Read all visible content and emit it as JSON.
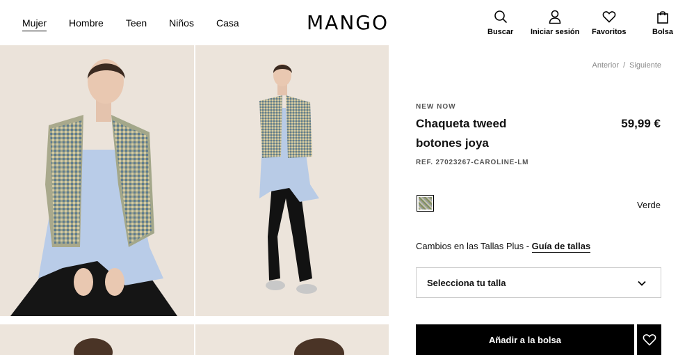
{
  "nav": {
    "items": [
      {
        "label": "Mujer",
        "active": true
      },
      {
        "label": "Hombre"
      },
      {
        "label": "Teen"
      },
      {
        "label": "Niños"
      },
      {
        "label": "Casa"
      }
    ]
  },
  "logo": "MANGO",
  "utilities": {
    "search": "Buscar",
    "login": "Iniciar sesión",
    "favorites": "Favoritos",
    "bag": "Bolsa"
  },
  "pager": {
    "prev": "Anterior",
    "separator": "/",
    "next": "Siguiente"
  },
  "product": {
    "tag": "NEW NOW",
    "title": "Chaqueta tweed botones joya",
    "price": "59,99 €",
    "ref": "REF. 27023267-CAROLINE-LM",
    "color_name": "Verde",
    "size_plus_text": "Cambios en las Tallas Plus - ",
    "size_guide": "Guía de tallas",
    "size_select_placeholder": "Selecciona tu talla",
    "add_to_bag": "Añadir a la bolsa"
  },
  "colors": {
    "accent": "#000000",
    "photo_bg": "#e9e0d6"
  }
}
